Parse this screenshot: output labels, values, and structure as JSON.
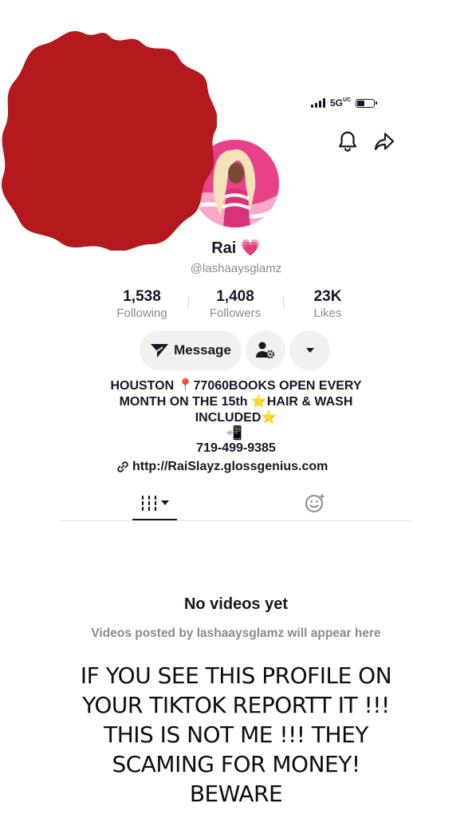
{
  "status_bar": {
    "network": "5G",
    "network_suffix": "UC"
  },
  "profile": {
    "display_name": "Rai",
    "name_emoji": "💗",
    "username": "@lashaaysglamz",
    "stats": [
      {
        "value": "1,538",
        "label": "Following"
      },
      {
        "value": "1,408",
        "label": "Followers"
      },
      {
        "value": "23K",
        "label": "Likes"
      }
    ],
    "actions": {
      "message_label": "Message"
    },
    "bio_lines": [
      "HOUSTON 📍77060BOOKS OPEN EVERY",
      "MONTH ON THE 15th ⭐HAIR & WASH",
      "INCLUDED⭐"
    ],
    "phone_emoji": "📲",
    "phone": "719-499-9385",
    "link": "http://RaiSlayz.glossgenius.com"
  },
  "tabs": [
    {
      "icon": "grid-videos-icon",
      "active": true
    },
    {
      "icon": "liked-videos-icon",
      "active": false
    }
  ],
  "empty_state": {
    "title": "No videos yet",
    "subtitle": "Videos posted by lashaaysglamz will appear here"
  },
  "overlay_warning": {
    "lines": [
      "IF YOU SEE THIS PROFILE ON",
      "YOUR TIKTOK REPORTT IT !!!",
      "THIS IS NOT ME !!! THEY",
      "SCAMING FOR MONEY!",
      "BEWARE"
    ]
  },
  "colors": {
    "seal_red": "#b3191d",
    "avatar_pink": "#e8418a",
    "muted_text": "#8a8b91",
    "button_bg": "#f1f1f2"
  }
}
